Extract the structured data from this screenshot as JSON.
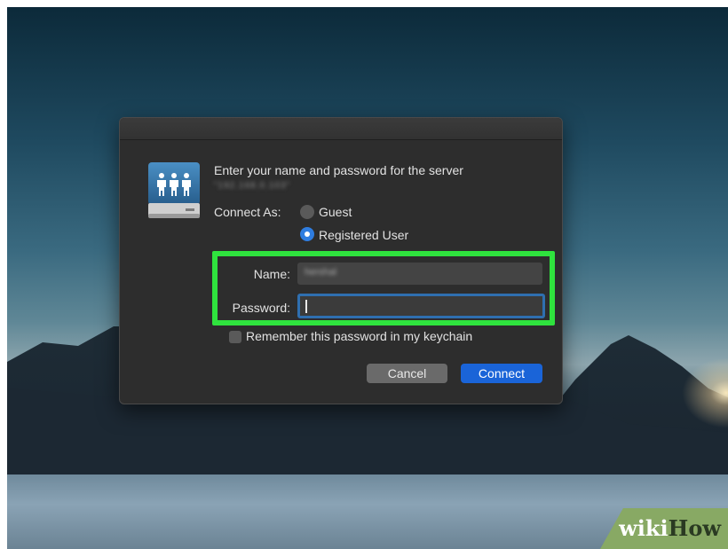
{
  "dialog": {
    "prompt": "Enter your name and password for the server",
    "server_address": "\"192.168.0.103\"",
    "connect_as_label": "Connect As:",
    "options": {
      "guest": "Guest",
      "registered": "Registered User",
      "selected": "registered"
    },
    "fields": {
      "name_label": "Name:",
      "name_value": "hershal",
      "password_label": "Password:",
      "password_value": ""
    },
    "remember_label": "Remember this password in my keychain",
    "remember_checked": false,
    "buttons": {
      "cancel": "Cancel",
      "connect": "Connect"
    },
    "highlight_color": "#2fe33e",
    "accent_color": "#1a64d8"
  },
  "icons": {
    "server": "server-users-icon"
  },
  "watermark": {
    "wiki": "wiki",
    "how": "How"
  }
}
